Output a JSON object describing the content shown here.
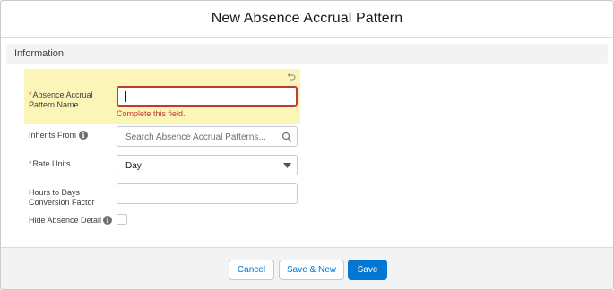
{
  "modal": {
    "title": "New Absence Accrual Pattern"
  },
  "section": {
    "title": "Information"
  },
  "fields": {
    "name": {
      "required_mark": "*",
      "label_line1": "Absence Accrual",
      "label_line2": "Pattern Name",
      "value": "",
      "error": "Complete this field."
    },
    "inherits_from": {
      "label": "Inherits From",
      "placeholder": "Search Absence Accrual Patterns..."
    },
    "rate_units": {
      "required_mark": "*",
      "label": "Rate Units",
      "value": "Day"
    },
    "conversion_factor": {
      "label_line1": "Hours to Days",
      "label_line2": "Conversion Factor",
      "value": ""
    },
    "hide_absence_detail": {
      "label": "Hide Absence Detail",
      "checked": false
    }
  },
  "footer": {
    "cancel_label": "Cancel",
    "save_new_label": "Save & New",
    "save_label": "Save"
  },
  "colors": {
    "brand": "#0176d3",
    "error": "#c23934",
    "highlight": "#fbf6b8"
  },
  "icons": {
    "undo": "undo-icon",
    "info": "info-icon",
    "search": "search-icon",
    "dropdown": "chevron-down-icon"
  }
}
